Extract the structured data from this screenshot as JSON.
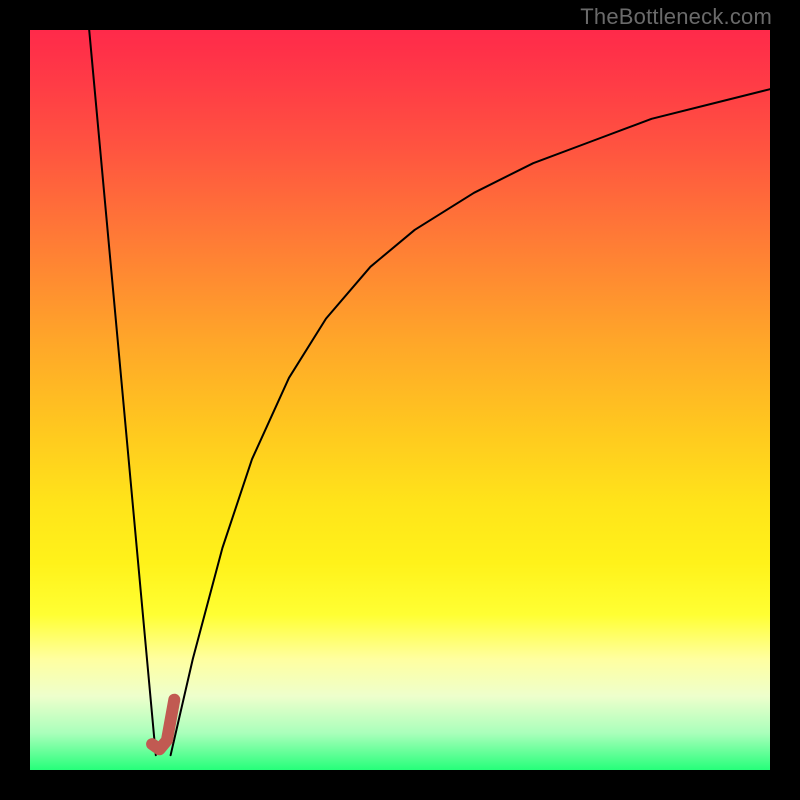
{
  "watermark": "TheBottleneck.com",
  "chart_data": {
    "type": "line",
    "title": "",
    "xlabel": "",
    "ylabel": "",
    "xlim": [
      0,
      100
    ],
    "ylim": [
      0,
      100
    ],
    "notes": "Vertical gradient background from red (top, high bottleneck) through orange/yellow to green (bottom, no bottleneck). Two black curves and one short salmon segment. Left curve: straight line from (~8, ~100) down to (~17, ~2). Right curve: rises from (~19, ~2) asymptotically toward (~100, ~92). Salmon thick segment near the valley from (~16.5, ~3.5) to (~19.5, ~9.5) marking the optimal point.",
    "series": [
      {
        "name": "left-line",
        "color": "#000000",
        "stroke_width": 2,
        "x": [
          8,
          17
        ],
        "y": [
          100,
          2
        ]
      },
      {
        "name": "right-curve",
        "color": "#000000",
        "stroke_width": 2,
        "x": [
          19,
          22,
          26,
          30,
          35,
          40,
          46,
          52,
          60,
          68,
          76,
          84,
          92,
          100
        ],
        "y": [
          2,
          15,
          30,
          42,
          53,
          61,
          68,
          73,
          78,
          82,
          85,
          88,
          90,
          92
        ]
      },
      {
        "name": "valley-marker",
        "color": "#c15a52",
        "stroke_width": 12,
        "x": [
          16.5,
          17.5,
          18.5,
          19.5
        ],
        "y": [
          3.5,
          2.8,
          4.0,
          9.5
        ]
      }
    ]
  }
}
